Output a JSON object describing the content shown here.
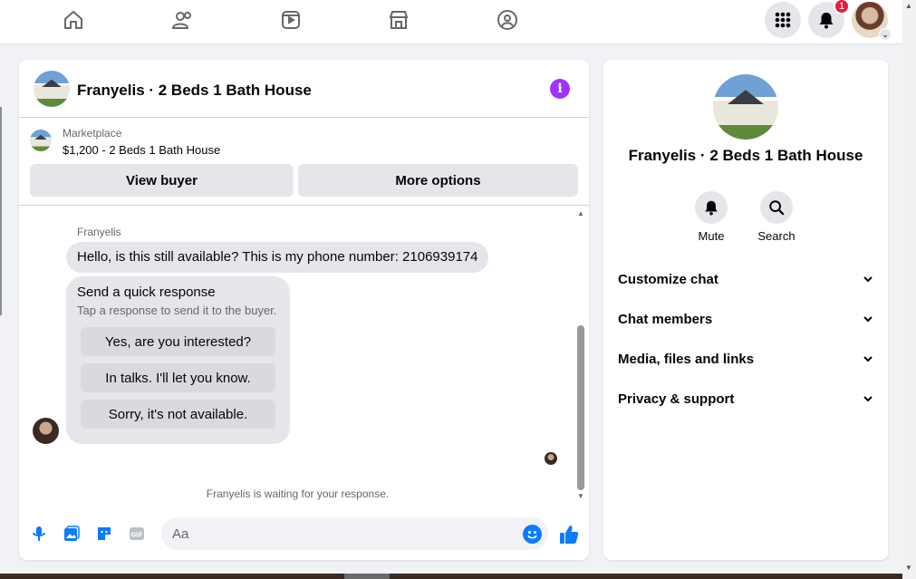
{
  "nav": {
    "icons": [
      "home-icon",
      "friends-icon",
      "watch-icon",
      "marketplace-icon",
      "groups-icon"
    ],
    "notifications_count": "1"
  },
  "chat": {
    "title": "Franyelis · 2 Beds 1 Bath House",
    "marketplace_label": "Marketplace",
    "listing_title": "$1,200 - 2 Beds 1 Bath House",
    "view_buyer_label": "View buyer",
    "more_options_label": "More options",
    "sender_name": "Franyelis",
    "message_text": "Hello, is this still available? This is my phone number: 2106939174",
    "quick_response": {
      "title": "Send a quick response",
      "subtitle": "Tap a response to send it to the buyer.",
      "options": [
        "Yes, are you interested?",
        "In talks. I'll let you know.",
        "Sorry, it's not available."
      ]
    },
    "waiting_text": "Franyelis is waiting for your response.",
    "composer": {
      "placeholder": "Aa",
      "icons": [
        "microphone-icon",
        "photo-icon",
        "sticker-icon",
        "gif-icon",
        "emoji-icon",
        "like-icon"
      ]
    }
  },
  "info_panel": {
    "title": "Franyelis · 2 Beds 1 Bath House",
    "mute_label": "Mute",
    "search_label": "Search",
    "sections": [
      "Customize chat",
      "Chat members",
      "Media, files and links",
      "Privacy & support"
    ]
  },
  "colors": {
    "accent_blue": "#0a7cff",
    "info_purple": "#a033ff",
    "badge_red": "#e41e3f",
    "bubble_gray": "#e4e6eb"
  }
}
